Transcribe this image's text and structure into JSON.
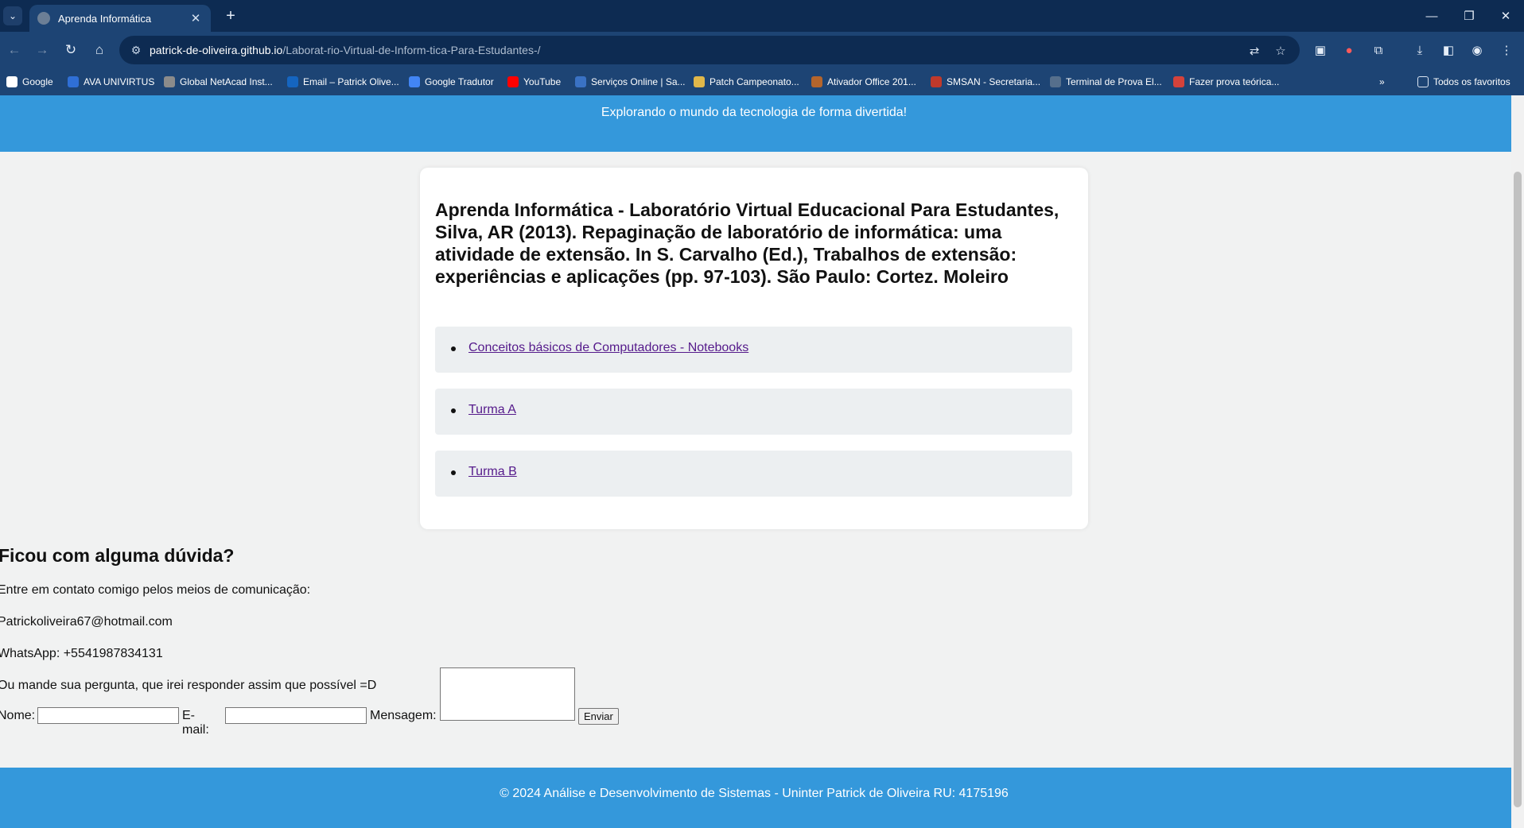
{
  "browser": {
    "tab_title": "Aprenda Informática",
    "url_host": "patrick-de-oliveira.github.io",
    "url_path": "/Laborat-rio-Virtual-de-Inform-tica-Para-Estudantes-/",
    "bookmarks": [
      {
        "label": "Google",
        "color": "#ffffff"
      },
      {
        "label": "AVA UNIVIRTUS",
        "color": "#2f6fd6"
      },
      {
        "label": "Global NetAcad Inst...",
        "color": "#8b8b8b"
      },
      {
        "label": "Email – Patrick Olive...",
        "color": "#1565c0"
      },
      {
        "label": "Google Tradutor",
        "color": "#4285f4"
      },
      {
        "label": "YouTube",
        "color": "#ff0000"
      },
      {
        "label": "Serviços Online | Sa...",
        "color": "#3a72c4"
      },
      {
        "label": "Patch Campeonato...",
        "color": "#e0b74a"
      },
      {
        "label": "Ativador Office 201...",
        "color": "#b4652c"
      },
      {
        "label": "SMSAN - Secretaria...",
        "color": "#c0392b"
      },
      {
        "label": "Terminal de Prova El...",
        "color": "#566f8c"
      },
      {
        "label": "Fazer prova teórica...",
        "color": "#d4423b"
      }
    ],
    "all_bookmarks": "Todos os favoritos"
  },
  "header": {
    "tagline": "Explorando o mundo da tecnologia de forma divertida!"
  },
  "card": {
    "title": "Aprenda Informática - Laboratório Virtual Educacional Para Estudantes, Silva, AR (2013). Repaginação de laboratório de informática: uma atividade de extensão. In S. Carvalho (Ed.), Trabalhos de extensão: experiências e aplicações (pp. 97-103). São Paulo: Cortez. Moleiro",
    "links": [
      "Conceitos básicos de Computadores - Notebooks",
      "Turma A",
      "Turma B"
    ]
  },
  "contact": {
    "title": "Ficou com alguma dúvida?",
    "intro": "Entre em contato comigo pelos meios de comunicação:",
    "email": "Patrickoliveira67@hotmail.com",
    "whatsapp": "WhatsApp: +5541987834131",
    "ask": "Ou mande sua pergunta, que irei responder assim que possível =D"
  },
  "form": {
    "name_label": "Nome:",
    "name_value": "",
    "email_label": "E-mail:",
    "email_value": "",
    "message_label": "Mensagem:",
    "message_value": "",
    "submit_label": "Enviar"
  },
  "footer": {
    "text": "© 2024 Análise e Desenvolvimento de Sistemas - Uninter Patrick de Oliveira RU: 4175196"
  },
  "colors": {
    "chrome_dark": "#0d2b52",
    "chrome": "#1d4474",
    "accent_blue": "#3498db",
    "link_visited": "#551a8b"
  }
}
